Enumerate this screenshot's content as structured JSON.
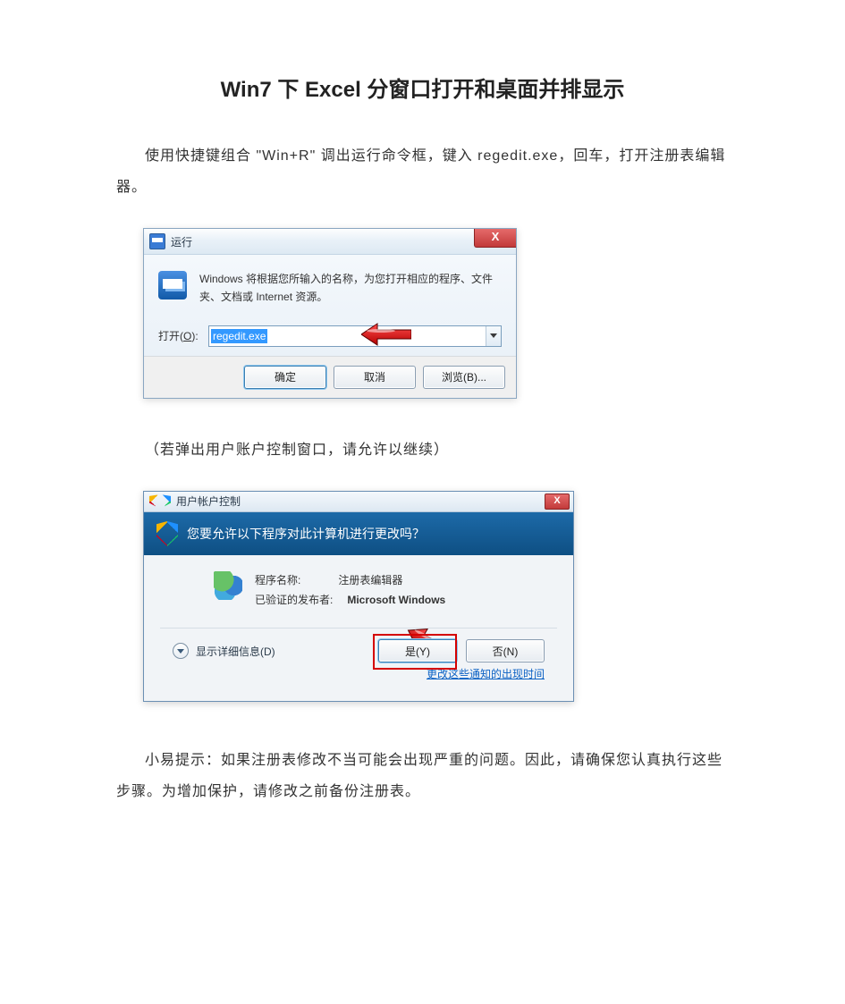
{
  "title": "Win7 下 Excel 分窗口打开和桌面并排显示",
  "para1": "使用快捷键组合 \"Win+R\" 调出运行命令框，键入 regedit.exe，回车，打开注册表编辑器。",
  "para2": "（若弹出用户账户控制窗口，请允许以继续）",
  "para3": "小易提示：如果注册表修改不当可能会出现严重的问题。因此，请确保您认真执行这些步骤。为增加保护，请修改之前备份注册表。",
  "run": {
    "title": "运行",
    "close": "X",
    "desc": "Windows 将根据您所输入的名称，为您打开相应的程序、文件夹、文档或 Internet 资源。",
    "open_label_prefix": "打开(",
    "open_label_underline": "O",
    "open_label_suffix": "):",
    "value": "regedit.exe",
    "ok": "确定",
    "cancel": "取消",
    "browse": "浏览(B)..."
  },
  "uac": {
    "title": "用户帐户控制",
    "close": "X",
    "question": "您要允许以下程序对此计算机进行更改吗？",
    "name_label": "程序名称:",
    "name_value": "注册表编辑器",
    "publisher_label": "已验证的发布者:",
    "publisher_value": "Microsoft Windows",
    "details": "显示详细信息(D)",
    "yes": "是(Y)",
    "no": "否(N)",
    "link": "更改这些通知的出现时间"
  }
}
